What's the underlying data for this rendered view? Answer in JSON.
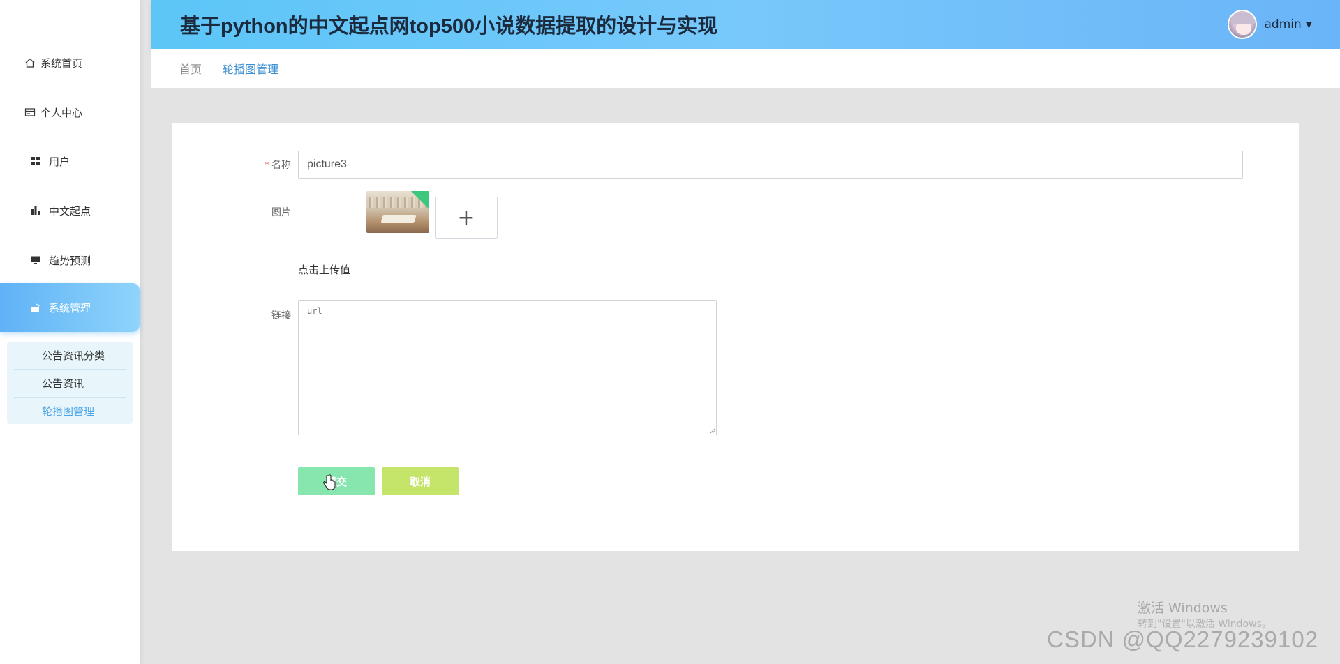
{
  "app": {
    "title": "基于python的中文起点网top500小说数据提取的设计与实现",
    "user": "admin"
  },
  "sidebar": {
    "items": [
      {
        "label": "系统首页",
        "icon": "home-icon"
      },
      {
        "label": "个人中心",
        "icon": "profile-card-icon"
      },
      {
        "label": "用户",
        "icon": "grid-icon"
      },
      {
        "label": "中文起点",
        "icon": "bar-chart-icon"
      },
      {
        "label": "趋势预测",
        "icon": "monitor-icon"
      },
      {
        "label": "系统管理",
        "icon": "settings-icon",
        "active": true
      }
    ],
    "submenu": [
      {
        "label": "公告资讯分类"
      },
      {
        "label": "公告资讯"
      },
      {
        "label": "轮播图管理",
        "current": true
      }
    ]
  },
  "breadcrumb": {
    "home": "首页",
    "current": "轮播图管理"
  },
  "form": {
    "name_label": "名称",
    "name_required_mark": "*",
    "name_value": "picture3",
    "image_label": "图片",
    "upload_plus": "+",
    "upload_tip": "点击上传值",
    "link_label": "链接",
    "link_placeholder": "url",
    "submit_label": "提交",
    "cancel_label": "取消"
  },
  "overlay": {
    "windows_activate": "激活 Windows",
    "windows_activate_sub": "转到\"设置\"以激活 Windows。",
    "csdn_watermark": "CSDN @QQ2279239102"
  },
  "colors": {
    "header_gradient_start": "#5cc6f7",
    "header_gradient_end": "#6ab4f8",
    "active_menu": "#5fb2f6",
    "submit_button": "#86e6ad",
    "cancel_button": "#c4e46a",
    "link_active": "#3b8fd2"
  }
}
